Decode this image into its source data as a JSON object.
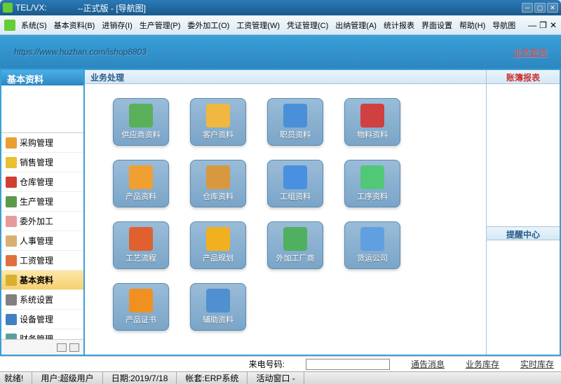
{
  "title": {
    "prefix": "TEL/VX:",
    "redacted": "",
    "suffix": "--正式版 - [导航图]"
  },
  "menu": [
    "系统(S)",
    "基本资料(B)",
    "进销存(I)",
    "生产管理(P)",
    "委外加工(O)",
    "工资管理(W)",
    "凭证管理(C)",
    "出纳管理(A)",
    "统计报表",
    "界面设置",
    "帮助(H)",
    "导航图"
  ],
  "banner": {
    "url": "https://www.huzhan.com/ishop8803",
    "search": "业务查询"
  },
  "sidebar": {
    "title": "基本资料",
    "items": [
      {
        "label": "采购管理",
        "c": "#e8a030"
      },
      {
        "label": "销售管理",
        "c": "#e8c030"
      },
      {
        "label": "仓库管理",
        "c": "#d04030"
      },
      {
        "label": "生产管理",
        "c": "#5a9a4a"
      },
      {
        "label": "委外加工",
        "c": "#e89a9a"
      },
      {
        "label": "人事管理",
        "c": "#d8b070"
      },
      {
        "label": "工资管理",
        "c": "#e07040"
      },
      {
        "label": "基本资料",
        "c": "#d8b030",
        "active": true
      },
      {
        "label": "系统设置",
        "c": "#808080"
      },
      {
        "label": "设备管理",
        "c": "#4080c0"
      },
      {
        "label": "财务管理",
        "c": "#5aa0a0"
      }
    ]
  },
  "main": {
    "title": "业务处理",
    "icons": [
      {
        "label": "供应商资料",
        "c": "#5ab05a"
      },
      {
        "label": "客户资料",
        "c": "#f0b840"
      },
      {
        "label": "职员资料",
        "c": "#4a90d8"
      },
      {
        "label": "物料资料",
        "c": "#d04040"
      },
      {
        "label": "产品资料",
        "c": "#f0a030"
      },
      {
        "label": "仓库资料",
        "c": "#d89840"
      },
      {
        "label": "工组资料",
        "c": "#4a90e0"
      },
      {
        "label": "工序资料",
        "c": "#50c878"
      },
      {
        "label": "工艺流程",
        "c": "#e06030"
      },
      {
        "label": "产品规划",
        "c": "#f0b020"
      },
      {
        "label": "外加工厂商",
        "c": "#50b060"
      },
      {
        "label": "货运公司",
        "c": "#60a0e0"
      },
      {
        "label": "产品证书",
        "c": "#f09020"
      },
      {
        "label": "辅助资料",
        "c": "#5090d0"
      }
    ]
  },
  "right": {
    "top": "账簿报表",
    "mid": "提醒中心"
  },
  "footer": {
    "label": "来电号码:",
    "l1": "通告消息",
    "l2": "业务库存",
    "l3": "实时库存"
  },
  "status": {
    "ready": "就绪!",
    "user": "用户:超级用户",
    "date": "日期:2019/7/18",
    "db": "帐套:ERP系统",
    "win": "活动窗口 -"
  }
}
